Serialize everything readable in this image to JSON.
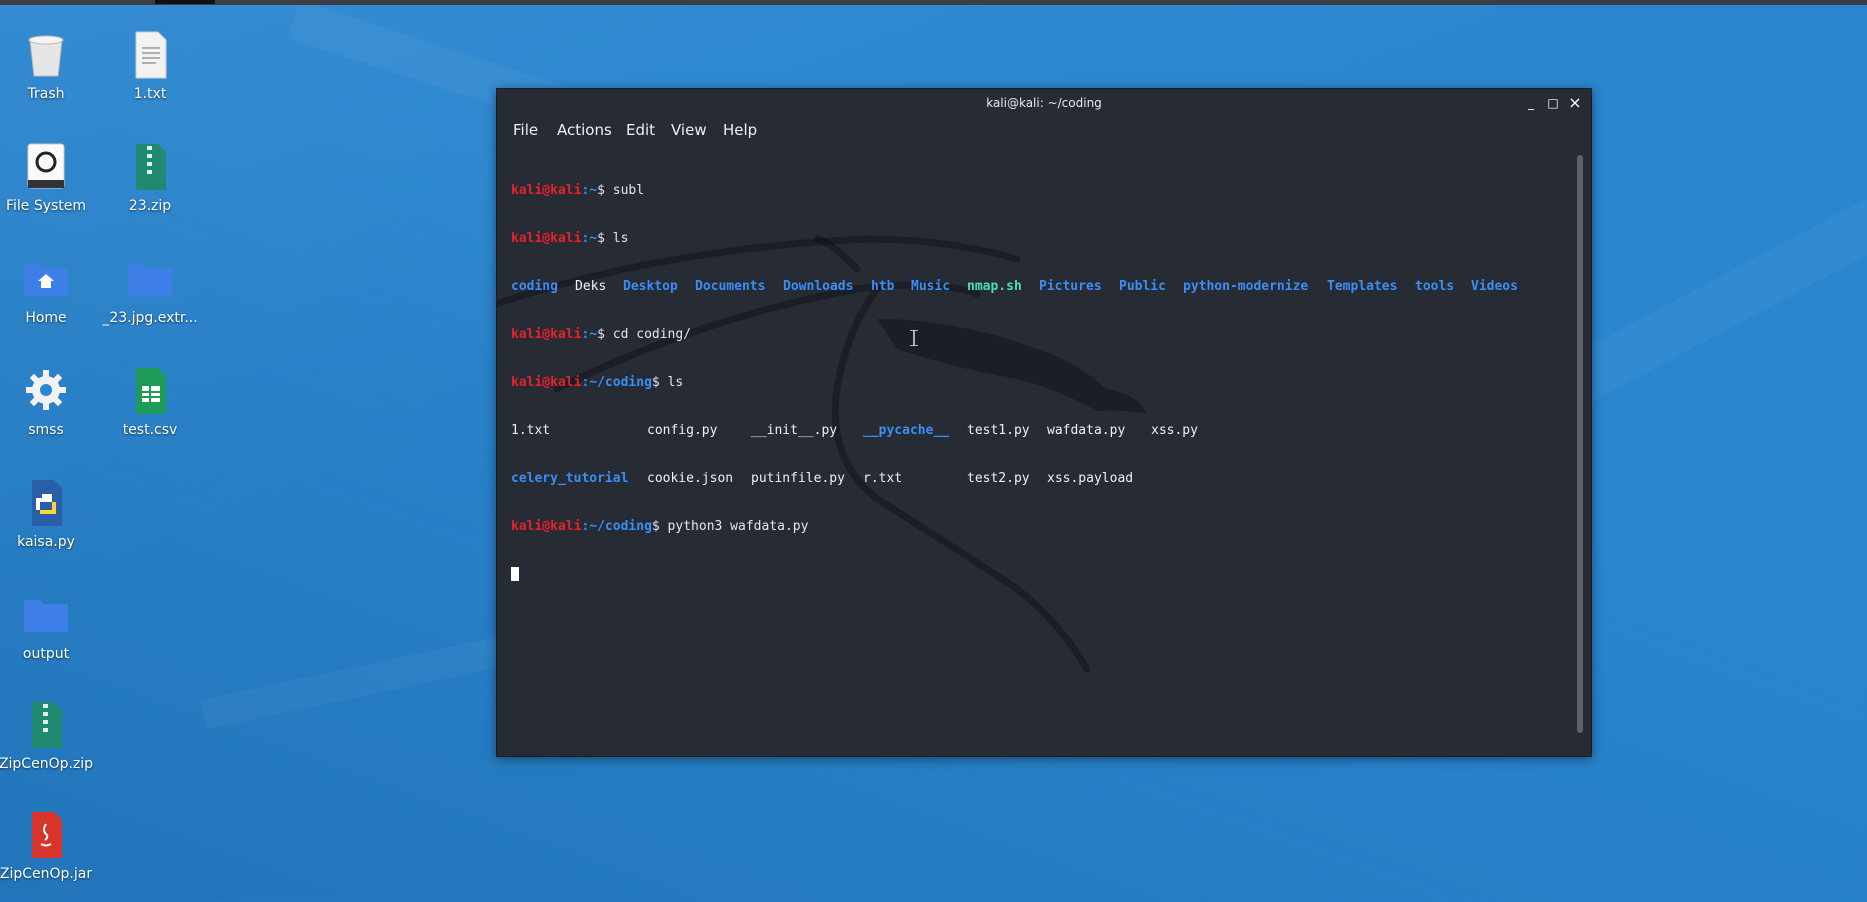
{
  "desktop": {
    "icons": [
      {
        "label": "Trash",
        "icon": "trash-icon"
      },
      {
        "label": "1.txt",
        "icon": "text-file-icon"
      },
      {
        "label": "File System",
        "icon": "drive-icon"
      },
      {
        "label": "23.zip",
        "icon": "zip-icon"
      },
      {
        "label": "Home",
        "icon": "home-folder-icon"
      },
      {
        "label": "_23.jpg.extr...",
        "icon": "folder-icon"
      },
      {
        "label": "smss",
        "icon": "gear-icon"
      },
      {
        "label": "test.csv",
        "icon": "spreadsheet-icon"
      },
      {
        "label": "kaisa.py",
        "icon": "python-file-icon"
      },
      {
        "label": "output",
        "icon": "folder-icon"
      },
      {
        "label": "ZipCenOp.zip",
        "icon": "zip-icon"
      },
      {
        "label": "ZipCenOp.jar",
        "icon": "java-file-icon"
      }
    ]
  },
  "terminal": {
    "title": "kali@kali: ~/coding",
    "window_buttons": {
      "minimize": "_",
      "maximize": "□",
      "close": "×"
    },
    "menu": [
      "File",
      "Actions",
      "Edit",
      "View",
      "Help"
    ],
    "prompt_user": "kali@kali",
    "lines": {
      "l1": {
        "path": ":~",
        "cmd": "$ subl"
      },
      "l2": {
        "path": ":~",
        "cmd": "$ ls"
      },
      "l3": [
        "coding",
        "Deks",
        "Desktop",
        "Documents",
        "Downloads",
        "htb",
        "Music",
        "nmap.sh",
        "Pictures",
        "Public",
        "python-modernize",
        "Templates",
        "tools",
        "Videos"
      ],
      "l4": {
        "path": ":~",
        "cmd": "$ cd coding/"
      },
      "l5": {
        "path": ":~/coding",
        "cmd": "$ ls"
      },
      "l6": [
        "1.txt",
        "config.py",
        "__init__.py",
        "__pycache__",
        "test1.py",
        "wafdata.py",
        "xss.py"
      ],
      "l7": [
        "celery_tutorial",
        "cookie.json",
        "putinfile.py",
        "r.txt",
        "test2.py",
        "xss.payload"
      ],
      "l8": {
        "path": ":~/coding",
        "cmd": "$ python3 wafdata.py"
      }
    },
    "colors": {
      "prompt": "#e81f2d",
      "dir": "#3b8ef5",
      "exec": "#4be0b0",
      "bg": "#262b34"
    }
  }
}
